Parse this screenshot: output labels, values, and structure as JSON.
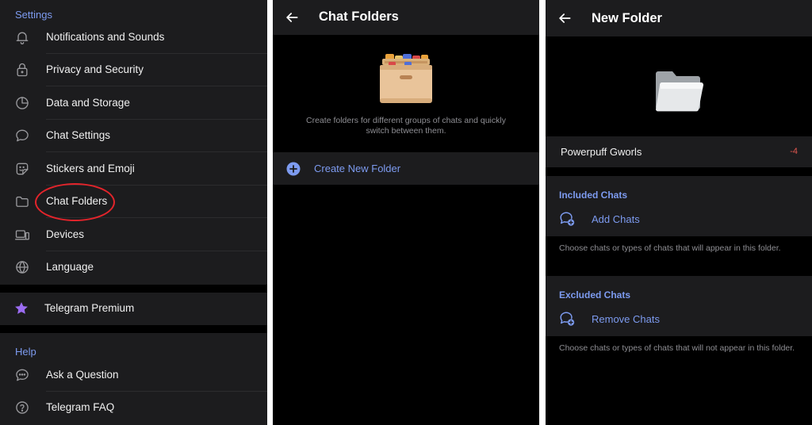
{
  "settings": {
    "section_title": "Settings",
    "items": [
      {
        "label": "Notifications and Sounds",
        "icon": "bell-icon"
      },
      {
        "label": "Privacy and Security",
        "icon": "lock-icon"
      },
      {
        "label": "Data and Storage",
        "icon": "pie-chart-icon"
      },
      {
        "label": "Chat Settings",
        "icon": "chat-bubble-icon"
      },
      {
        "label": "Stickers and Emoji",
        "icon": "sticker-icon"
      },
      {
        "label": "Chat Folders",
        "icon": "folder-icon"
      },
      {
        "label": "Devices",
        "icon": "devices-icon"
      },
      {
        "label": "Language",
        "icon": "globe-icon"
      }
    ],
    "premium_label": "Telegram Premium",
    "help_title": "Help",
    "help_items": [
      {
        "label": "Ask a Question",
        "icon": "chat-dots-icon"
      },
      {
        "label": "Telegram FAQ",
        "icon": "question-circle-icon"
      }
    ]
  },
  "chat_folders": {
    "title": "Chat Folders",
    "description": "Create folders for different groups of chats and quickly switch between them.",
    "create_label": "Create New Folder"
  },
  "new_folder": {
    "title": "New Folder",
    "name_value": "Powerpuff Gworls",
    "name_counter": "-4",
    "included_title": "Included Chats",
    "add_label": "Add Chats",
    "included_hint": "Choose chats or types of chats that will appear in this folder.",
    "excluded_title": "Excluded Chats",
    "remove_label": "Remove Chats",
    "excluded_hint": "Choose chats or types of chats that will not appear in this folder."
  },
  "colors": {
    "accent": "#7d9bf0",
    "background": "#000000",
    "card": "#1c1c1e",
    "highlight": "#e3242b",
    "premium_star": "#9b6cf2"
  }
}
